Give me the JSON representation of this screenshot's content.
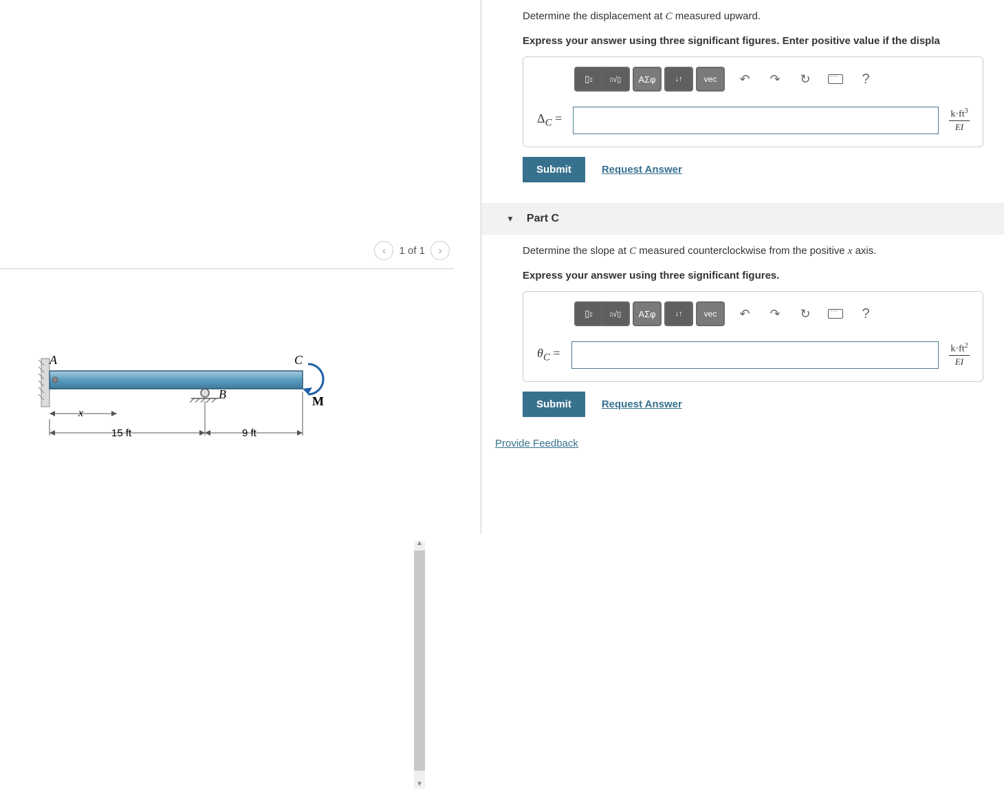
{
  "pager": {
    "label": "1 of 1"
  },
  "figure": {
    "label_A": "A",
    "label_B": "B",
    "label_C": "C",
    "label_M": "M",
    "label_x": "x",
    "dim1": "15 ft",
    "dim2": "9 ft"
  },
  "partB": {
    "question_line1_prefix": "Determine the displacement at ",
    "question_line1_var": "C",
    "question_line1_suffix": " measured upward.",
    "question_line2": "Express your answer using three significant figures. Enter positive value if the displa",
    "symbol_prefix": "Δ",
    "symbol_sub": "C",
    "symbol_eq": " =",
    "unit_num": "k·ft",
    "unit_exp": "3",
    "unit_den": "EI",
    "submit_label": "Submit",
    "request_label": "Request Answer"
  },
  "partC": {
    "header": "Part C",
    "question_line1_prefix": "Determine the slope at ",
    "question_line1_var": "C",
    "question_line1_mid": " measured counterclockwise from the positive ",
    "question_line1_var2": "x",
    "question_line1_suffix": " axis.",
    "question_line2": "Express your answer using three significant figures.",
    "symbol_prefix": "θ",
    "symbol_sub": "C",
    "symbol_eq": " =",
    "unit_num": "k·ft",
    "unit_exp": "2",
    "unit_den": "EI",
    "submit_label": "Submit",
    "request_label": "Request Answer"
  },
  "toolbar": {
    "templates": "▯",
    "sqrt": "√▯",
    "greek": "ΑΣφ",
    "arrows": "↓↑",
    "vec": "vec",
    "undo": "↶",
    "redo": "↷",
    "reset": "↻",
    "help": "?"
  },
  "feedback_link": "Provide Feedback"
}
